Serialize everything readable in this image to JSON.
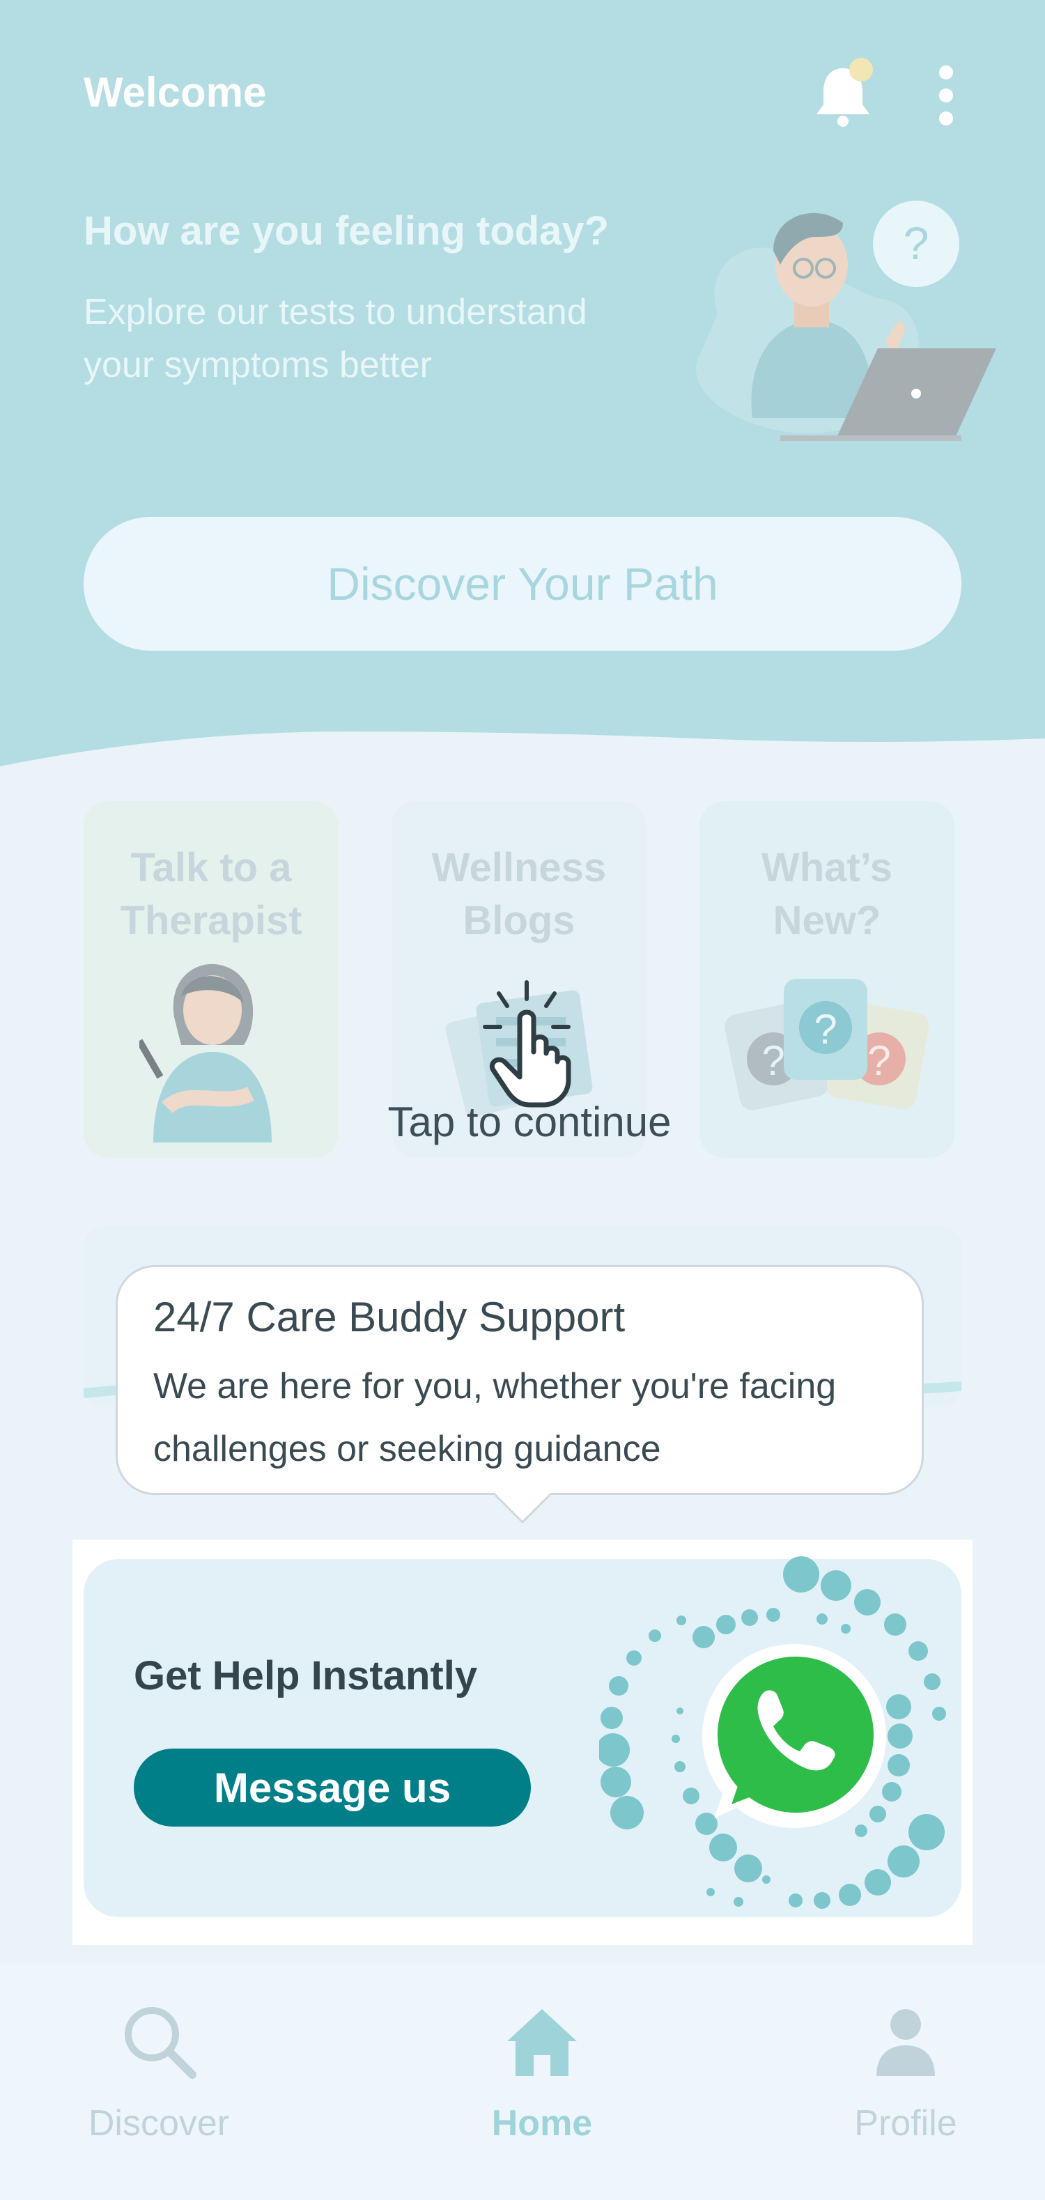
{
  "header": {
    "welcome": "Welcome",
    "question": "How are you feeling today?",
    "subtitle": "Explore our tests to understand your symptoms better",
    "cta": "Discover Your Path"
  },
  "cards": [
    {
      "label": "Talk to a\nTherapist"
    },
    {
      "label": "Wellness\nBlogs"
    },
    {
      "label": "What’s\nNew?"
    }
  ],
  "overlay": {
    "tap_text": "Tap to continue"
  },
  "tooltip": {
    "title": "24/7 Care Buddy Support",
    "body": "We are here for you, whether you're facing challenges or seeking guidance"
  },
  "help": {
    "title": "Get Help Instantly",
    "button": "Message us"
  },
  "nav": {
    "items": [
      {
        "label": "Discover",
        "icon": "search-icon"
      },
      {
        "label": "Home",
        "icon": "home-icon",
        "active": true
      },
      {
        "label": "Profile",
        "icon": "profile-icon"
      }
    ]
  },
  "colors": {
    "header_bg": "#b3dde3",
    "page_bg": "#e9f3f8",
    "accent": "#007f89",
    "whatsapp": "#2fbd4a"
  }
}
